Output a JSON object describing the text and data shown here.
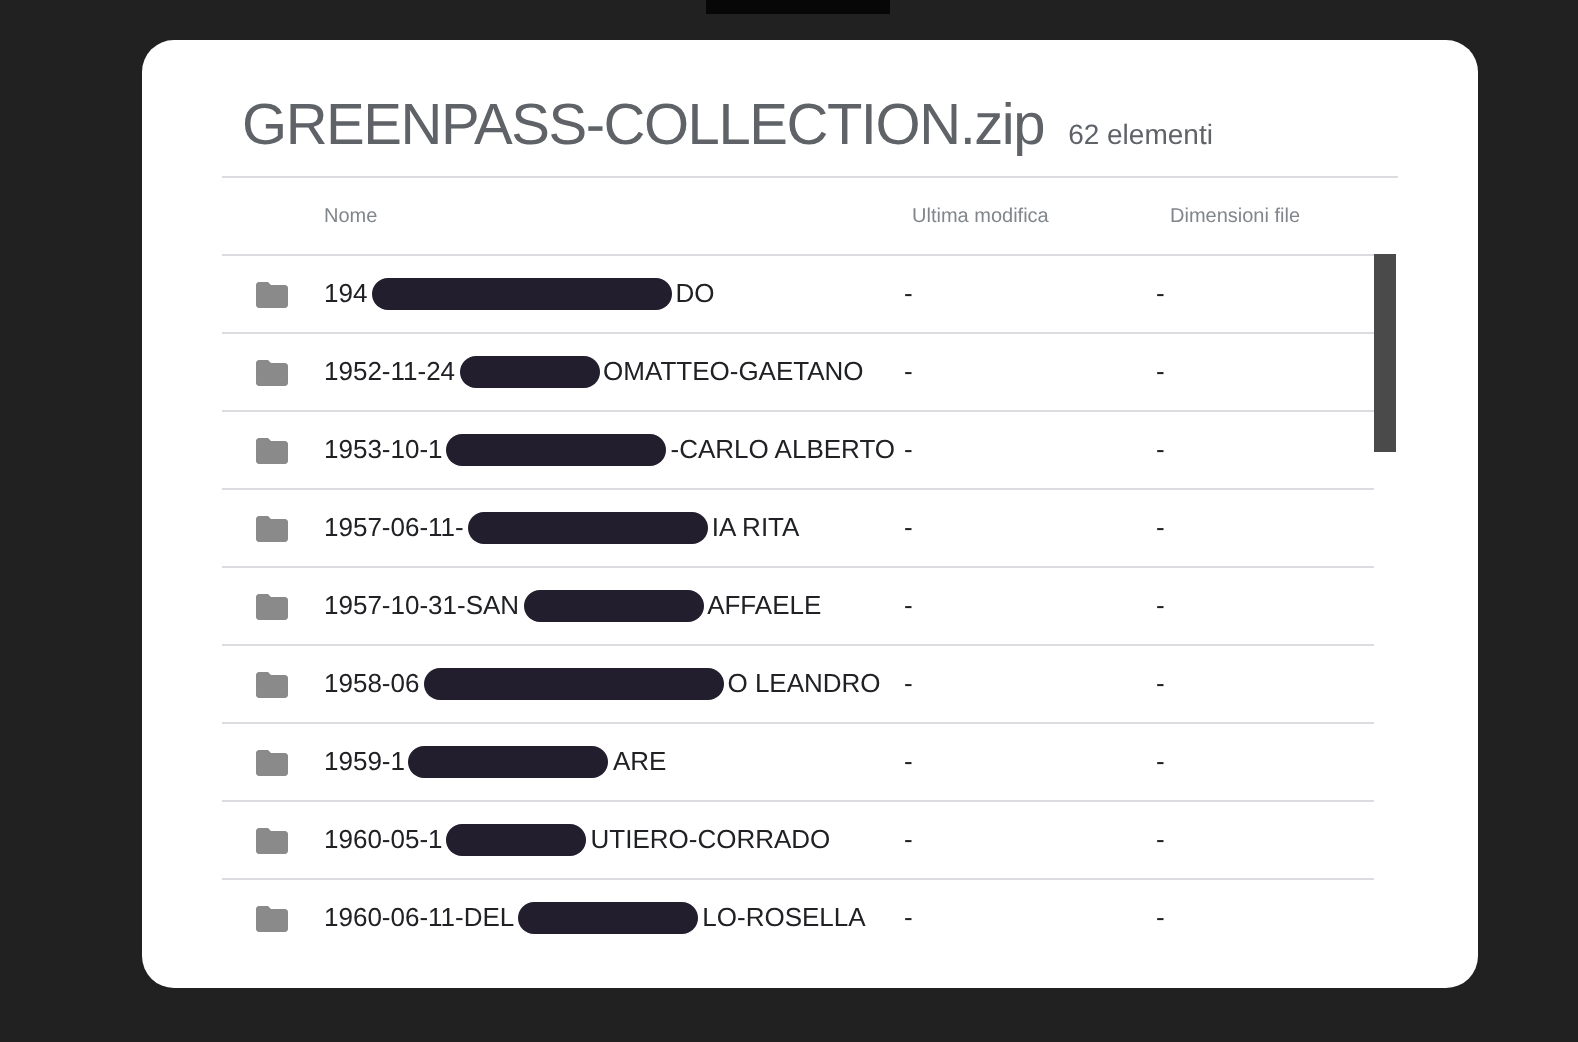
{
  "title": "GREENPASS-COLLECTION.zip",
  "count": "62 elementi",
  "columns": [
    "Nome",
    "Ultima modifica",
    "Dimensioni file"
  ],
  "rows": [
    {
      "name_start": "194",
      "name_end": "DO",
      "modified": "-",
      "size": "-"
    },
    {
      "name_start": "1952-11-24",
      "name_end": "OMATTEO-GAETANO",
      "modified": "-",
      "size": "-"
    },
    {
      "name_start": "1953-10-1",
      "name_end": "-CARLO ALBERTO",
      "modified": "-",
      "size": "-"
    },
    {
      "name_start": "1957-06-11-",
      "name_end": "IA RITA",
      "modified": "-",
      "size": "-"
    },
    {
      "name_start": "1957-10-31-SAN",
      "name_end": "AFFAELE",
      "modified": "-",
      "size": "-"
    },
    {
      "name_start": "1958-06",
      "name_end": "O LEANDRO",
      "modified": "-",
      "size": "-"
    },
    {
      "name_start": "1959-1",
      "name_end": "ARE",
      "modified": "-",
      "size": "-"
    },
    {
      "name_start": "1960-05-1",
      "name_end": "UTIERO-CORRADO",
      "modified": "-",
      "size": "-"
    },
    {
      "name_start": "1960-06-11-DEL",
      "name_end": "LO-ROSELLA",
      "modified": "-",
      "size": "-"
    }
  ]
}
